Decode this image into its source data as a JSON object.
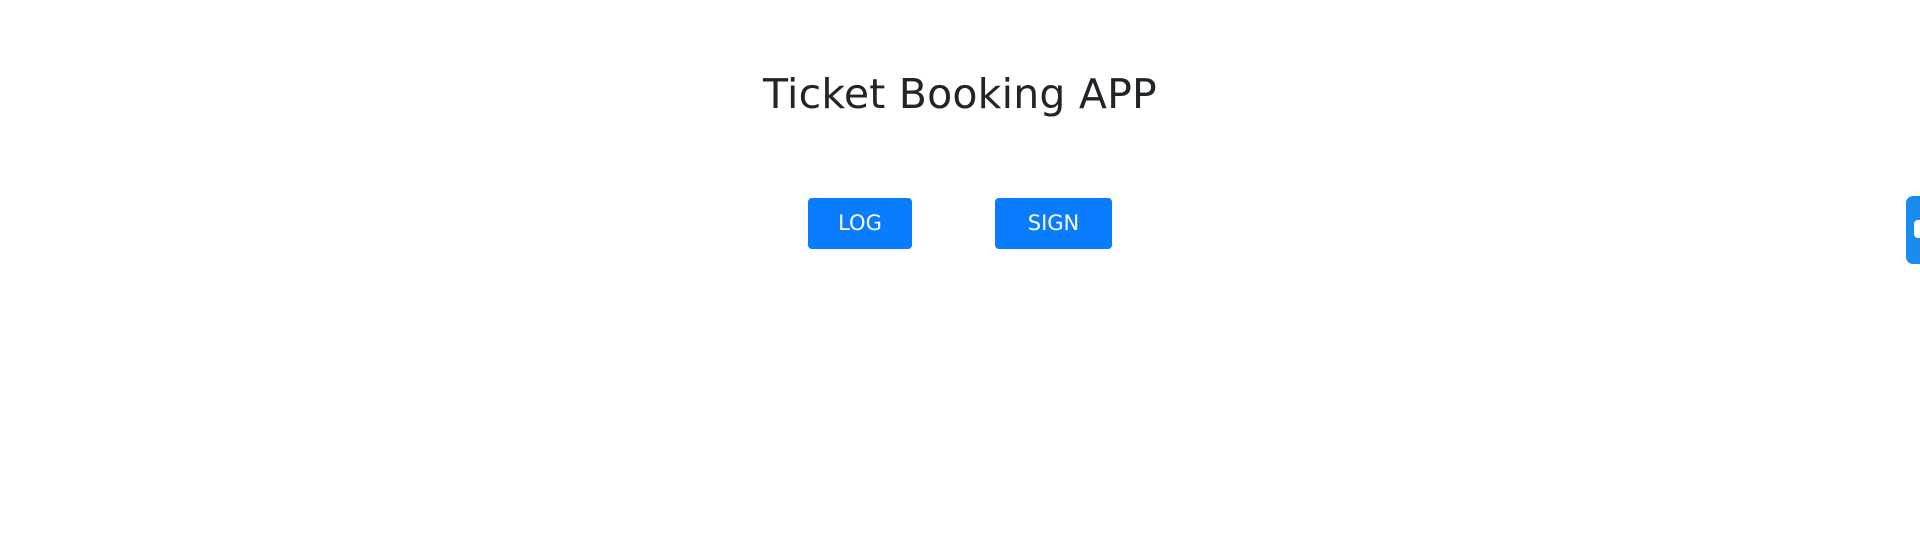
{
  "header": {
    "title": "Ticket Booking APP"
  },
  "actions": {
    "login_label": "LOG IN",
    "signup_label": "SIGN UP"
  },
  "colors": {
    "primary": "#0a7cff",
    "edge_tab": "#1a8cf0",
    "text": "#212529",
    "background": "#ffffff"
  },
  "icons": {
    "edge_tab_icon": "feedback-icon"
  }
}
